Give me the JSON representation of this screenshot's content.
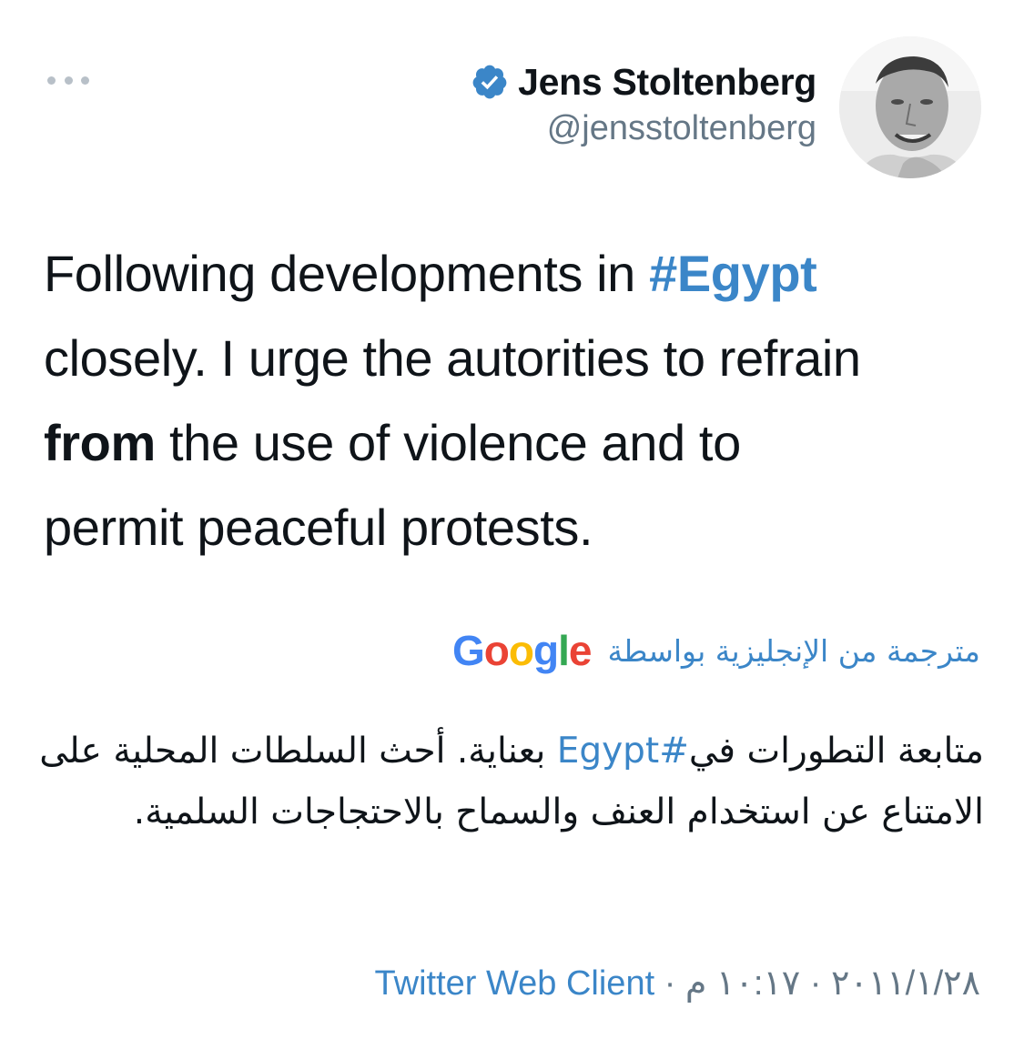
{
  "author": {
    "display_name": "Jens Stoltenberg",
    "handle": "@jensstoltenberg",
    "verified": true,
    "verified_icon": "verified-badge-icon"
  },
  "more_icon": "more-horizontal-icon",
  "tweet": {
    "line1_pre": "Following developments in ",
    "hashtag": "#Egypt",
    "line2": "closely. I urge the autorities to refrain",
    "line3_bold": "from",
    "line3_rest": " the use of violence and to",
    "line4": "permit peaceful protests."
  },
  "translation": {
    "label": "مترجمة من الإنجليزية بواسطة",
    "provider": "Google",
    "text_part1": "متابعة التطورات في",
    "text_hashtag": "#Egypt",
    "text_part2": " بعناية. أحث السلطات المحلية على الامتناع عن استخدام العنف والسماح بالاحتجاجات السلمية."
  },
  "meta": {
    "date": "٢٠١١/١/٢٨",
    "separator": "·",
    "time": "١٠:١٧ م",
    "client": "Twitter Web Client"
  },
  "colors": {
    "link": "#3b86c8",
    "muted": "#657786",
    "text": "#0f1419",
    "google_blue": "#4285F4",
    "google_red": "#EA4335",
    "google_yellow": "#FBBC05",
    "google_green": "#34A853"
  }
}
